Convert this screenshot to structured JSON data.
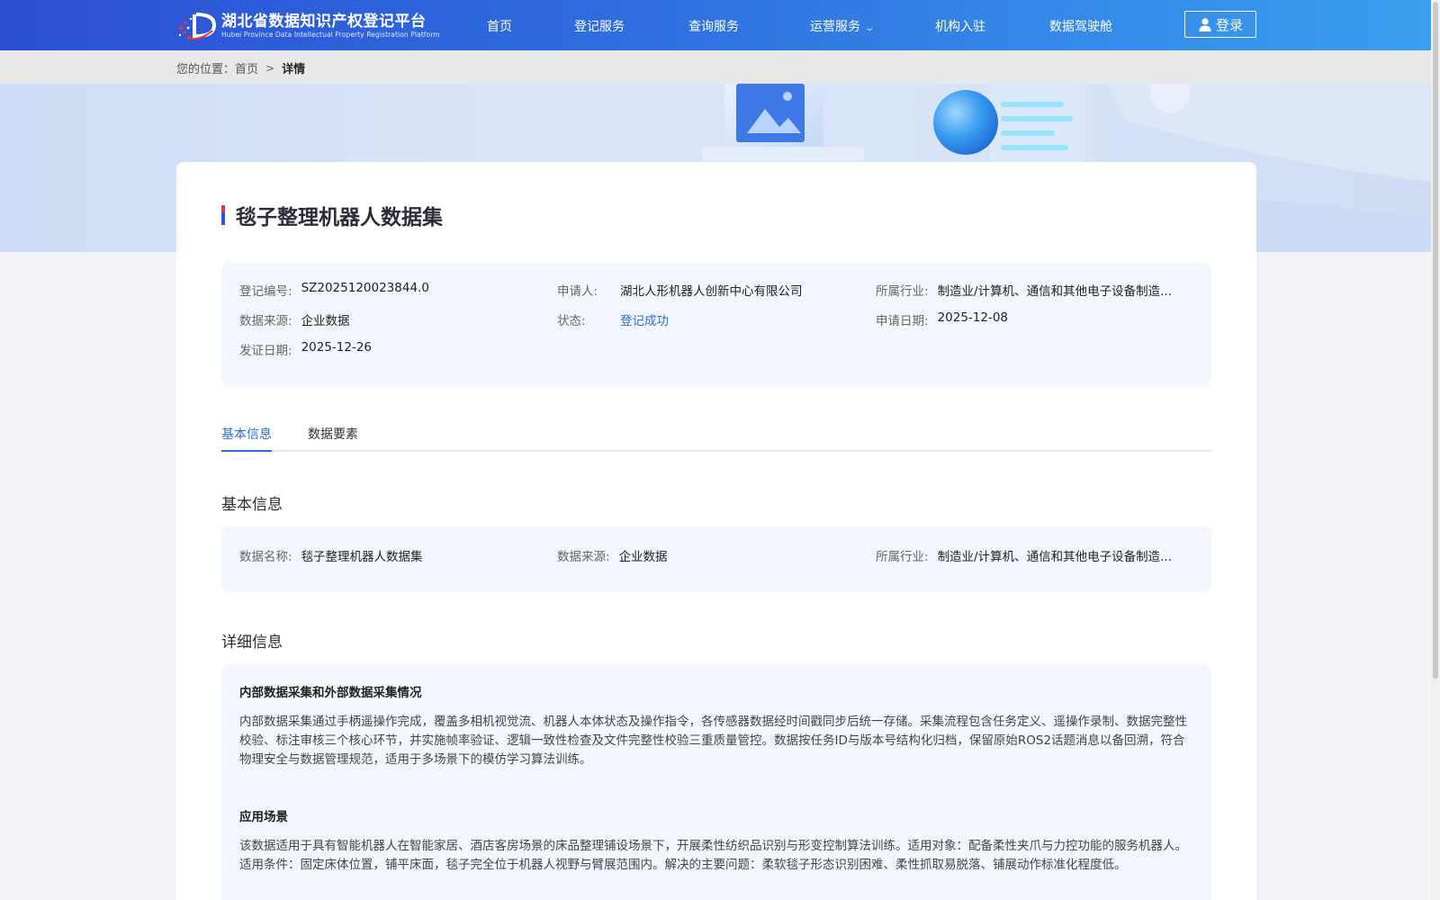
{
  "header": {
    "logo_cn": "湖北省数据知识产权登记平台",
    "logo_en": "Hubei Province Data Intellectual Property Registration Platform",
    "nav": [
      {
        "label": "首页"
      },
      {
        "label": "登记服务"
      },
      {
        "label": "查询服务"
      },
      {
        "label": "运营服务"
      },
      {
        "label": "机构入驻"
      },
      {
        "label": "数据驾驶舱"
      }
    ],
    "login_label": "登录"
  },
  "breadcrumb": {
    "prefix": "您的位置：",
    "home": "首页",
    "current": "详情"
  },
  "detail": {
    "title": "毯子整理机器人数据集",
    "summary": {
      "reg_no_label": "登记编号:",
      "reg_no": "SZ2025120023844.0",
      "applicant_label": "申请人:",
      "applicant": "湖北人形机器人创新中心有限公司",
      "industry_label": "所属行业:",
      "industry": "制造业/计算机、通信和其他电子设备制造...",
      "source_label": "数据来源:",
      "source": "企业数据",
      "status_label": "状态:",
      "status": "登记成功",
      "apply_date_label": "申请日期:",
      "apply_date": "2025-12-08",
      "issue_date_label": "发证日期:",
      "issue_date": "2025-12-26"
    },
    "tabs": [
      {
        "label": "基本信息"
      },
      {
        "label": "数据要素"
      }
    ],
    "basic_title": "基本信息",
    "basic": {
      "name_label": "数据名称:",
      "name": "毯子整理机器人数据集",
      "source_label": "数据来源:",
      "source": "企业数据",
      "industry_label": "所属行业:",
      "industry": "制造业/计算机、通信和其他电子设备制造..."
    },
    "detail_title": "详细信息",
    "sections": [
      {
        "heading": "内部数据采集和外部数据采集情况",
        "text": "内部数据采集通过手柄遥操作完成，覆盖多相机视觉流、机器人本体状态及操作指令，各传感器数据经时间戳同步后统一存储。采集流程包含任务定义、遥操作录制、数据完整性校验、标注审核三个核心环节，并实施帧率验证、逻辑一致性检查及文件完整性校验三重质量管控。数据按任务ID与版本号结构化归档，保留原始ROS2话题消息以备回溯，符合物理安全与数据管理规范，适用于多场景下的模仿学习算法训练。"
      },
      {
        "heading": "应用场景",
        "text": "该数据适用于具有智能机器人在智能家居、酒店客房场景的床品整理铺设场景下，开展柔性纺织品识别与形变控制算法训练。适用对象：配备柔性夹爪与力控功能的服务机器人。适用条件：固定床体位置，铺平床面，毯子完全位于机器人视野与臂展范围内。解决的主要问题：柔软毯子形态识别困难、柔性抓取易脱落、铺展动作标准化程度低。"
      }
    ]
  }
}
